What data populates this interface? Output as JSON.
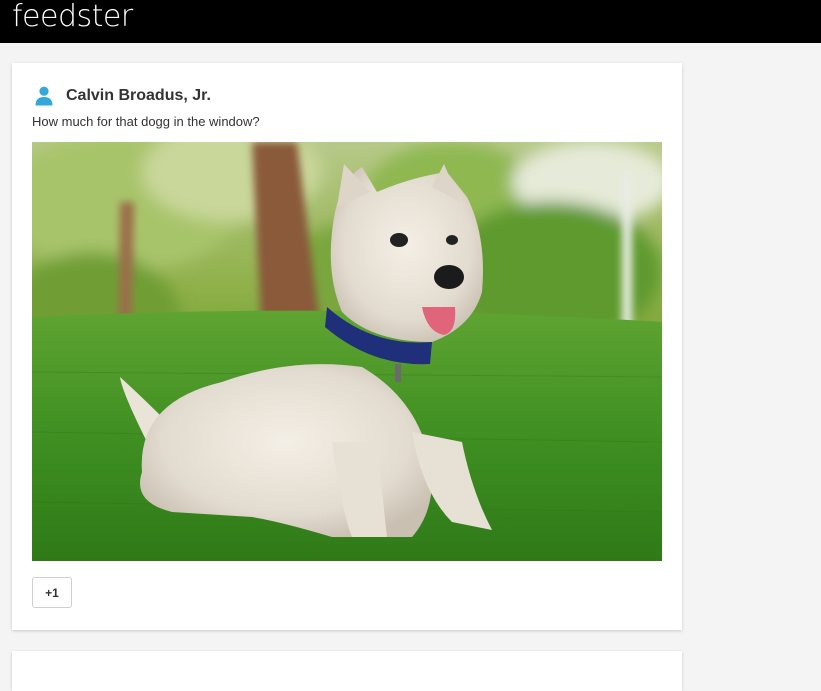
{
  "app": {
    "brand": "feedster"
  },
  "post": {
    "author": "Calvin Broadus, Jr.",
    "text": "How much for that dogg in the window?",
    "user_icon": "person-icon",
    "image": "west-highland-terrier-on-grass",
    "plus_label": "+1"
  },
  "colors": {
    "topbar": "#000000",
    "page_background": "#f4f4f4",
    "user_icon": "#33a7da"
  }
}
